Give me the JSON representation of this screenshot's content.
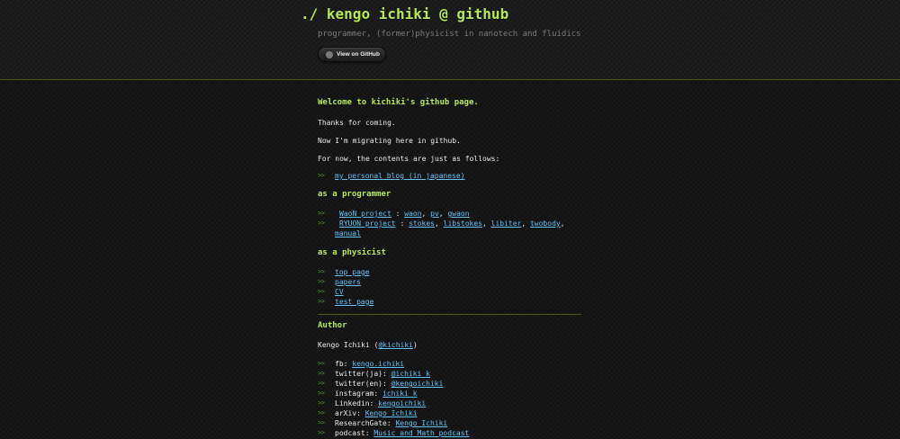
{
  "header": {
    "prefix": "./",
    "title": "kengo ichiki @ github",
    "subtitle": "programmer, (former)physicist in nanotech and fluidics",
    "github_button": "View on GitHub",
    "github_icon": "github-octocat-icon"
  },
  "main": {
    "welcome": "Welcome to kichiki's github page.",
    "lines": [
      "Thanks for coming.",
      "Now I'm migrating here in github.",
      "For now, the contents are just as follows:"
    ],
    "bullet": ">>",
    "blog_link": "my personal blog (in japanese)",
    "programmer": {
      "heading": "as a programmer",
      "waon_label": "WaoN project",
      "waon_links": [
        "waon",
        "pv",
        "gwaon"
      ],
      "ryuon_label": "RYUON project",
      "ryuon_links": [
        "stokes",
        "libstokes",
        "libiter",
        "twobody",
        "manual"
      ],
      "sep_colon": " : ",
      "sep_comma": ", "
    },
    "physicist": {
      "heading": "as a physicist",
      "links": [
        "top page",
        "papers",
        "CV",
        "test page"
      ]
    },
    "author": {
      "heading": "Author",
      "name_prefix": "Kengo Ichiki (",
      "name_link": "@kichiki",
      "name_suffix": ")",
      "contacts": [
        {
          "label": "fb: ",
          "link": "kengo.ichiki"
        },
        {
          "label": "twitter(ja): ",
          "link": "@ichiki_k"
        },
        {
          "label": "twitter(en): ",
          "link": "@kengoichiki"
        },
        {
          "label": "instagram: ",
          "link": "ichiki_k"
        },
        {
          "label": "Linkedin: ",
          "link": "kengoichiki"
        },
        {
          "label": "arXiv: ",
          "link": "Kengo Ichiki"
        },
        {
          "label": "ResearchGate: ",
          "link": "Kengo Ichiki"
        },
        {
          "label": "podcast: ",
          "link": "Music and Math podcast"
        }
      ]
    }
  },
  "colors": {
    "accent_green": "#b5e853",
    "link_blue": "#63c0f5",
    "background": "#151515",
    "bullet_green": "#4f9b2f"
  }
}
